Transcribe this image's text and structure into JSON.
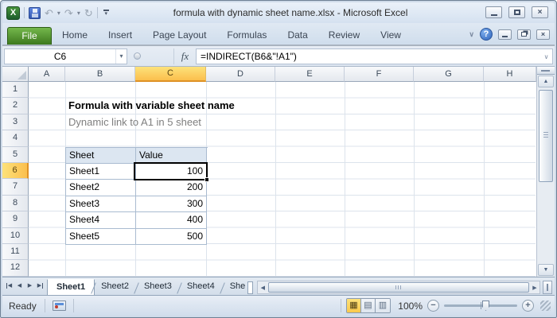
{
  "title_bar": {
    "title": "formula with dynamic sheet name.xlsx  -  Microsoft Excel"
  },
  "ribbon": {
    "file_tab": "File",
    "tabs": [
      "Home",
      "Insert",
      "Page Layout",
      "Formulas",
      "Data",
      "Review",
      "View"
    ]
  },
  "formula_bar": {
    "name_box": "C6",
    "fx_label": "fx",
    "formula": "=INDIRECT(B6&\"!A1\")"
  },
  "grid": {
    "columns": [
      "A",
      "B",
      "C",
      "D",
      "E",
      "F",
      "G",
      "H"
    ],
    "rows": [
      "1",
      "2",
      "3",
      "4",
      "5",
      "6",
      "7",
      "8",
      "9",
      "10",
      "11",
      "12"
    ],
    "selected_cell": "C6",
    "selected_column": "C",
    "selected_row": "6",
    "content": {
      "title": "Formula with variable sheet name",
      "subtitle": "Dynamic link to A1 in 5 sheet"
    },
    "table": {
      "headers": [
        "Sheet",
        "Value"
      ],
      "rows": [
        [
          "Sheet1",
          "100"
        ],
        [
          "Sheet2",
          "200"
        ],
        [
          "Sheet3",
          "300"
        ],
        [
          "Sheet4",
          "400"
        ],
        [
          "Sheet5",
          "500"
        ]
      ]
    }
  },
  "sheet_tabs": {
    "tabs": [
      "Sheet1",
      "Sheet2",
      "Sheet3",
      "Sheet4",
      "She"
    ],
    "active": "Sheet1"
  },
  "status_bar": {
    "status": "Ready",
    "zoom_level": "100%"
  },
  "icons": {
    "excel_logo": "X",
    "undo": "↶",
    "redo": "↷",
    "repeat": "↻",
    "dropdown_caret": "▾",
    "close": "×",
    "help": "?",
    "ribbon_collapse": "∨",
    "name_dropdown": "▾",
    "formula_expand": "∨",
    "nav_prev": "◀",
    "nav_next": "▶",
    "scroll_up": "▲",
    "scroll_down": "▼",
    "scroll_left": "◀",
    "scroll_right": "▶",
    "view_normal": "▦",
    "view_page_layout": "▤",
    "view_page_break": "▥",
    "zoom_out": "−",
    "zoom_in": "+"
  },
  "colors": {
    "selected_header_fill": "#fbc94c",
    "table_header_fill": "#dce6f1",
    "file_tab_green": "#4a8722",
    "help_blue": "#2e63ba",
    "gridline": "#dce3ec",
    "selection_border": "#000000",
    "subtitle_gray": "#7f7f7f"
  }
}
